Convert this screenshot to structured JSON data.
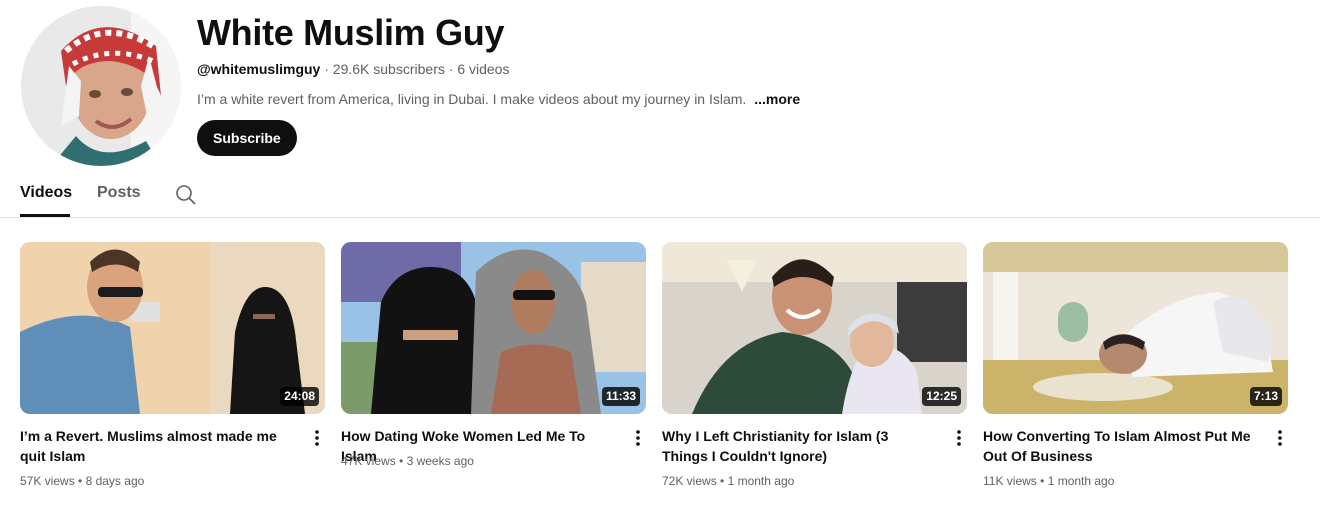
{
  "channel": {
    "name": "White Muslim Guy",
    "handle": "@whitemuslimguy",
    "subscribers": "29.6K subscribers",
    "videos_count": "6 videos",
    "separator": " · ",
    "description": "I’m a white revert from America, living in Dubai. I make videos about my journey in Islam.",
    "more_label": "...more",
    "subscribe_label": "Subscribe"
  },
  "tabs": [
    {
      "label": "Videos",
      "active": true
    },
    {
      "label": "Posts",
      "active": false
    }
  ],
  "videos": [
    {
      "title": "I’m a Revert. Muslims almost made me quit Islam",
      "views": "57K views",
      "age": "8 days ago",
      "duration": "24:08"
    },
    {
      "title": "How Dating Woke Women Led Me To Islam",
      "views": "47K views",
      "age": "3 weeks ago",
      "duration": "11:33"
    },
    {
      "title": "Why I Left Christianity for Islam (3 Things I Couldn't Ignore)",
      "views": "72K views",
      "age": "1 month ago",
      "duration": "12:25"
    },
    {
      "title": "How Converting To Islam Almost Put Me Out Of Business",
      "views": "11K views",
      "age": "1 month ago",
      "duration": "7:13"
    }
  ],
  "meta_separator": " • ",
  "colors": {
    "subscribe_bg": "#0f0f0f",
    "text_primary": "#0f0f0f",
    "text_secondary": "#606060"
  }
}
